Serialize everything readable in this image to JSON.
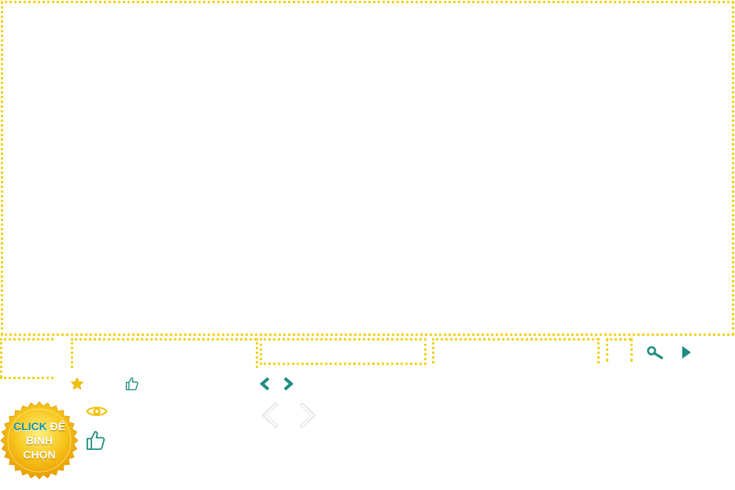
{
  "colors": {
    "frame": "#f2d21e",
    "teal": "#1e8c82",
    "star": "#f2c200",
    "badge_gold": "#f5b800"
  },
  "icons": {
    "search": "search-icon",
    "play": "play-icon",
    "star": "star-icon",
    "like_small": "thumbs-up-icon",
    "eye": "eye-icon",
    "like_large": "thumbs-up-icon",
    "prev_teal": "chevron-left-icon",
    "next_teal": "chevron-right-icon",
    "prev_light": "chevron-left-icon",
    "next_light": "chevron-right-icon"
  },
  "vote_badge": {
    "word_click": "CLICK",
    "word_de": "ĐỂ",
    "line2": "BÌNH",
    "line3": "CHỌN"
  }
}
